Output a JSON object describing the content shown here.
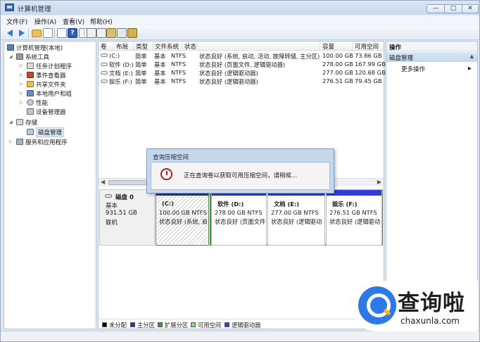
{
  "window": {
    "title": "计算机管理",
    "controls": {
      "minimize": "—",
      "maximize": "□",
      "close": "✕"
    }
  },
  "menu": [
    "文件(F)",
    "操作(A)",
    "查看(V)",
    "帮助(H)"
  ],
  "toolbar": {
    "icons": [
      "back-icon",
      "forward-icon",
      "folder-up-icon",
      "console-tree-icon",
      "properties-icon",
      "help-icon",
      "export-icon",
      "disk-icon"
    ]
  },
  "tree": {
    "root": "计算机管理(本地)",
    "items": [
      {
        "label": "系统工具",
        "level": 1,
        "expanded": true
      },
      {
        "label": "任务计划程序",
        "level": 2
      },
      {
        "label": "事件查看器",
        "level": 2
      },
      {
        "label": "共享文件夹",
        "level": 2
      },
      {
        "label": "本地用户和组",
        "level": 2
      },
      {
        "label": "性能",
        "level": 2
      },
      {
        "label": "设备管理器",
        "level": 2
      },
      {
        "label": "存储",
        "level": 1,
        "expanded": true
      },
      {
        "label": "磁盘管理",
        "level": 2,
        "selected": true
      },
      {
        "label": "服务和应用程序",
        "level": 1
      }
    ]
  },
  "volume_table": {
    "columns": [
      "卷",
      "布局",
      "类型",
      "文件系统",
      "状态",
      "容量",
      "可用空间"
    ],
    "rows": [
      [
        "(C:)",
        "简单",
        "基本",
        "NTFS",
        "状态良好 (系统, 启动, 活动, 故障转储, 主分区)",
        "100.00 GB",
        "73.86 GB"
      ],
      [
        "软件 (D:)",
        "简单",
        "基本",
        "NTFS",
        "状态良好 (页面文件, 逻辑驱动器)",
        "278.00 GB",
        "167.99 GB"
      ],
      [
        "文档 (E:)",
        "简单",
        "基本",
        "NTFS",
        "状态良好 (逻辑驱动器)",
        "277.00 GB",
        "120.68 GB"
      ],
      [
        "娱乐 (F:)",
        "简单",
        "基本",
        "NTFS",
        "状态良好 (逻辑驱动器)",
        "276.51 GB",
        "79.45 GB"
      ]
    ]
  },
  "disk": {
    "name": "磁盘 0",
    "type": "基本",
    "size": "931.51 GB",
    "status": "联机",
    "partitions": [
      {
        "name": "(C:)",
        "size": "100.00 GB NTFS",
        "status": "状态良好 (系统, 启"
      },
      {
        "name": "软件  (D:)",
        "size": "278.00 GB NTFS",
        "status": "状态良好 (页面文件"
      },
      {
        "name": "文档  (E:)",
        "size": "277.00 GB NTFS",
        "status": "状态良好 (逻辑驱动"
      },
      {
        "name": "娱乐  (F:)",
        "size": "276.51 GB NTFS",
        "status": "状态良好 (逻辑驱动"
      }
    ]
  },
  "legend": [
    {
      "label": "未分配",
      "color": "#000000"
    },
    {
      "label": "主分区",
      "color": "#1f3c9c"
    },
    {
      "label": "扩展分区",
      "color": "#2ea23a"
    },
    {
      "label": "可用空间",
      "color": "#7fe07f"
    },
    {
      "label": "逻辑驱动器",
      "color": "#2f3fd4"
    }
  ],
  "actions": {
    "title": "操作",
    "section": "磁盘管理",
    "more": "更多操作"
  },
  "dialog": {
    "title": "查询压缩空间",
    "message": "正在查询卷以获取可用压缩空间，请稍候..."
  },
  "watermark": {
    "cn": "查询啦",
    "en": "chaxunla.com"
  },
  "colors": {
    "primary_band": "#1f3c9c",
    "logical_band": "#2f3fd4",
    "extended_border": "#2ea23a",
    "watermark_blue": "#2f79e6"
  }
}
